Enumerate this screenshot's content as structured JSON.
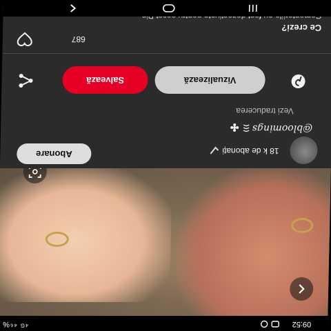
{
  "status_bar": {
    "time": "09:52",
    "right_text": "⁴ᴳ ⁴⁶%"
  },
  "author": {
    "subscribers": "18 k de abonați",
    "follow_button": "Abonare",
    "handle": "@bloomings"
  },
  "panel": {
    "translate_link": "Vezi traducerea",
    "save_button": "Salvează",
    "view_button": "Vizualizează",
    "likes_count": "687",
    "comments_heading": "Ce crezi?",
    "comments_disabled": "Comentariile au fost dezactivate pentru acest Pin"
  },
  "colors": {
    "panel_bg": "#2b2b2b",
    "save_red": "#e60023",
    "view_gray": "#cfcfcf",
    "follow_gray": "#dedede"
  },
  "icons": [
    "back-arrow-icon",
    "lens-search-icon",
    "share-icon",
    "pinterest-icon",
    "heart-icon",
    "verified-icon",
    "nav-back-icon",
    "nav-home-icon",
    "nav-recents-icon"
  ]
}
